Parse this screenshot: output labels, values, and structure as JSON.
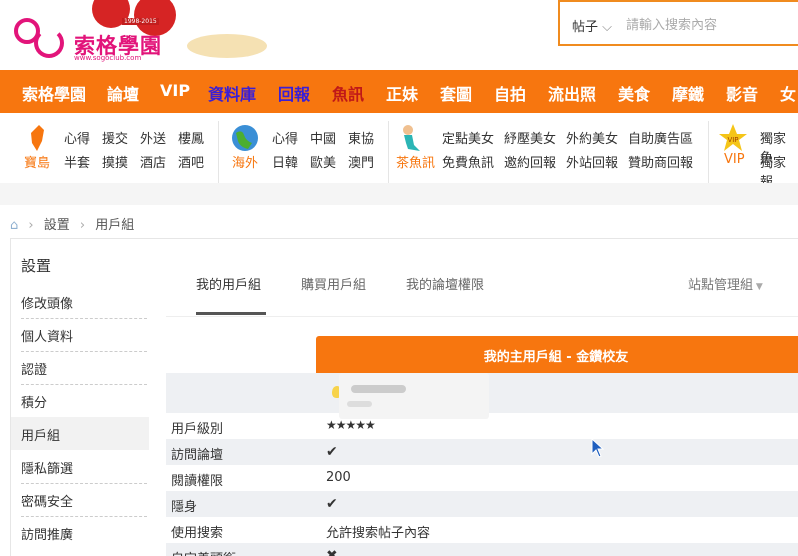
{
  "header": {
    "logo_text": "索格學園",
    "logo_sub": "www.sogoclub.com",
    "logo_year": "1998-2015",
    "search_type": "帖子",
    "search_placeholder": "請輸入搜索內容"
  },
  "nav": {
    "items": [
      {
        "label": "索格學園",
        "color": "#ffffff"
      },
      {
        "label": "論壇",
        "color": "#ffffff"
      },
      {
        "label": "VIP",
        "color": "#ffffff"
      },
      {
        "label": "資料庫",
        "color": "#3a1fd6"
      },
      {
        "label": "回報",
        "color": "#3a1fd6"
      },
      {
        "label": "魚訊",
        "color": "#c01818"
      },
      {
        "label": "正妹",
        "color": "#ffffff"
      },
      {
        "label": "套圖",
        "color": "#ffffff"
      },
      {
        "label": "自拍",
        "color": "#ffffff"
      },
      {
        "label": "流出照",
        "color": "#ffffff"
      },
      {
        "label": "美食",
        "color": "#ffffff"
      },
      {
        "label": "摩鐵",
        "color": "#ffffff"
      },
      {
        "label": "影音",
        "color": "#ffffff"
      },
      {
        "label": "女",
        "color": "#ffffff"
      }
    ]
  },
  "subnav": {
    "sections": [
      {
        "label": "寶島",
        "icon": "taiwan-map-icon",
        "links": [
          "心得",
          "援交",
          "外送",
          "樓鳳",
          "半套",
          "摸摸",
          "酒店",
          "酒吧"
        ]
      },
      {
        "label": "海外",
        "icon": "globe-icon",
        "links": [
          "心得",
          "中國",
          "東協",
          "日韓",
          "歐美",
          "澳門"
        ]
      },
      {
        "label": "茶魚訊",
        "icon": "mermaid-icon",
        "links": [
          "定點美女",
          "紓壓美女",
          "外約美女",
          "自助廣告區",
          "免費魚訊",
          "邀約回報",
          "外站回報",
          "贊助商回報"
        ]
      },
      {
        "label": "VIP",
        "icon": "vip-star-icon",
        "links": [
          "獨家魚",
          "獨家報"
        ]
      }
    ]
  },
  "breadcrumb": {
    "home_icon": "home-icon",
    "items": [
      "設置",
      "用戶組"
    ]
  },
  "sidebar": {
    "title": "設置",
    "items": [
      "修改頭像",
      "個人資料",
      "認證",
      "積分",
      "用戶組",
      "隱私篩選",
      "密碼安全",
      "訪問推廣"
    ],
    "active_index": 4
  },
  "tabs": {
    "items": [
      "我的用戶組",
      "購買用戶組",
      "我的論壇權限"
    ],
    "active_index": 0,
    "right_label": "站點管理組"
  },
  "group": {
    "banner": "我的主用戶組 - 金鑽校友",
    "rows": [
      {
        "label": "用戶級別",
        "value": "★★★★★",
        "kind": "stars"
      },
      {
        "label": "訪問論壇",
        "value": "✔",
        "kind": "check"
      },
      {
        "label": "閱讀權限",
        "value": "200",
        "kind": "text"
      },
      {
        "label": "隱身",
        "value": "✔",
        "kind": "check"
      },
      {
        "label": "使用搜索",
        "value": "允許搜索帖子內容",
        "kind": "text"
      },
      {
        "label": "自定義頭銜",
        "value": "✖",
        "kind": "cross"
      }
    ]
  },
  "colors": {
    "accent": "#f7760f",
    "nav_blue": "#3a1fd6",
    "nav_red": "#c01818",
    "check": "#4cae31"
  }
}
